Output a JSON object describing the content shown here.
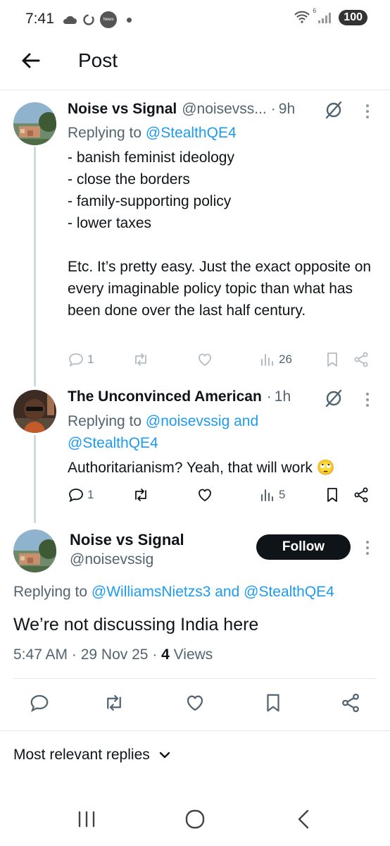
{
  "status_bar": {
    "time": "7:41",
    "left_icons": [
      "cloud-icon",
      "sync-icon",
      "news-icon",
      "dot-icon"
    ],
    "news_badge": "News",
    "wifi_label": "6",
    "battery": "100"
  },
  "header": {
    "title": "Post"
  },
  "replies": [
    {
      "name": "Noise vs Signal",
      "handle": "@noisevss...",
      "separator": "·",
      "time": "9h",
      "replying_prefix": "Replying to ",
      "replying_mentions": "@StealthQE4",
      "text": "- banish feminist ideology\n- close the borders\n- family-supporting policy\n- lower taxes\n\nEtc. It’s pretty easy. Just the exact opposite on every imaginable policy topic than what has been done over the last half century.",
      "replies_count": "1",
      "views": "26"
    },
    {
      "name": "The Unconvinced American",
      "separator": "·",
      "time": "1h",
      "replying_prefix": "Replying to ",
      "replying_mention_1": "@noisevssig",
      "replying_and": " and",
      "replying_mention_2": "@StealthQE4",
      "text": "Authoritarianism? Yeah, that will work 🙄",
      "replies_count": "1",
      "views": "5"
    }
  ],
  "main_post": {
    "name": "Noise vs Signal",
    "handle": "@noisevssig",
    "follow_label": "Follow",
    "replying_prefix": "Replying to ",
    "replying_mention_1": "@WilliamsNietzs3",
    "replying_and": " and ",
    "replying_mention_2": "@StealthQE4",
    "text": "We’re not discussing India here",
    "time": "5:47 AM",
    "sep1": " · ",
    "date": "29 Nov 25",
    "sep2": " · ",
    "views_count": "4",
    "views_label": " Views"
  },
  "sort": {
    "label": "Most relevant replies"
  },
  "nav": [
    "recent-apps-icon",
    "home-icon",
    "back-icon"
  ],
  "colors": {
    "accent": "#1d9bf0",
    "text": "#0f1419",
    "secondary": "#536471",
    "line": "#cfd9de"
  }
}
